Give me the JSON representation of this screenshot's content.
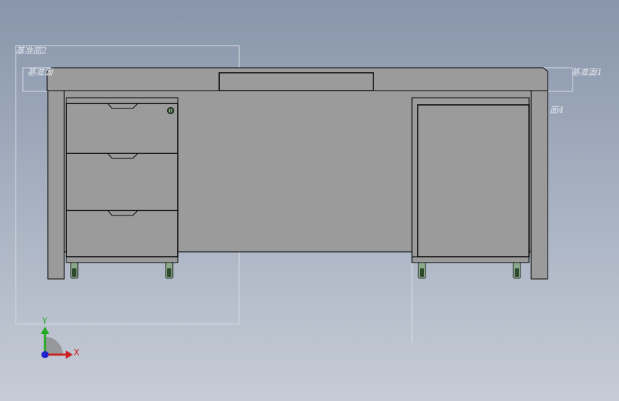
{
  "window": {
    "type": "CAD 3D viewport",
    "model": "desk with drawer pedestal and cabinet pedestal, front view"
  },
  "reference_planes": {
    "top_left": "基准面2",
    "left": "基准面",
    "right": "基准面1",
    "right_inner": "面4"
  },
  "triad": {
    "x_label": "X",
    "y_label": "Y"
  },
  "colors": {
    "background_top": "#8896ab",
    "background_bottom": "#c6ccd6",
    "part_fill": "#9b9b9b",
    "edge": "#000000",
    "caster": "#2f4a2f",
    "axis_x": "#cc2222",
    "axis_y": "#22aa22",
    "axis_z": "#2222cc"
  },
  "icons": [
    "lock-icon",
    "caster-icon",
    "coordinate-triad-icon"
  ]
}
